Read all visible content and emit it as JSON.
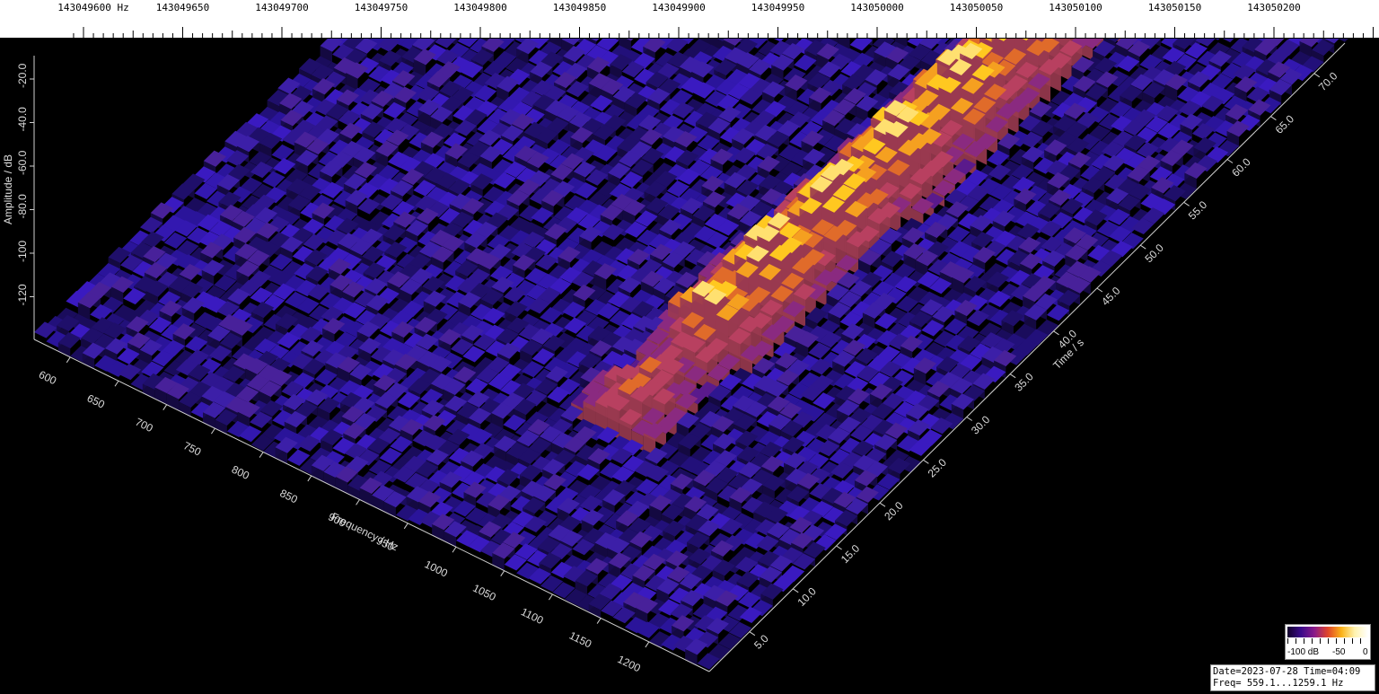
{
  "header": {
    "rf_freq_labels": [
      "143049600 Hz",
      "143049650",
      "143049700",
      "143049750",
      "143049800",
      "143049850",
      "143049900",
      "143049950",
      "143050000",
      "143050050",
      "143050100",
      "143050150",
      "143050200"
    ]
  },
  "axes": {
    "amplitude_label": "Amplitude / dB",
    "amplitude_ticks": [
      "-20.0",
      "-40.0",
      "-60.0",
      "-80.0",
      "-100",
      "-120"
    ],
    "frequency_label": "Frequency / Hz",
    "frequency_ticks": [
      "600",
      "650",
      "700",
      "750",
      "800",
      "850",
      "900",
      "950",
      "1000",
      "1050",
      "1100",
      "1150",
      "1200"
    ],
    "time_label": "Time / s",
    "time_ticks": [
      "5.0",
      "10.0",
      "15.0",
      "20.0",
      "25.0",
      "30.0",
      "35.0",
      "40.0",
      "45.0",
      "50.0",
      "55.0",
      "60.0",
      "65.0",
      "70.0"
    ]
  },
  "colorbar": {
    "min_label": "-100 dB",
    "mid_label": "-50",
    "max_label": "0"
  },
  "info": {
    "line1": "Date=2023-07-28 Time=04:09",
    "line2": "Freq= 559.1...1259.1 Hz"
  },
  "colors": {
    "background": "#000000",
    "noise_floor": "#2d1aa0",
    "signal_peak": "#fbb218"
  }
}
